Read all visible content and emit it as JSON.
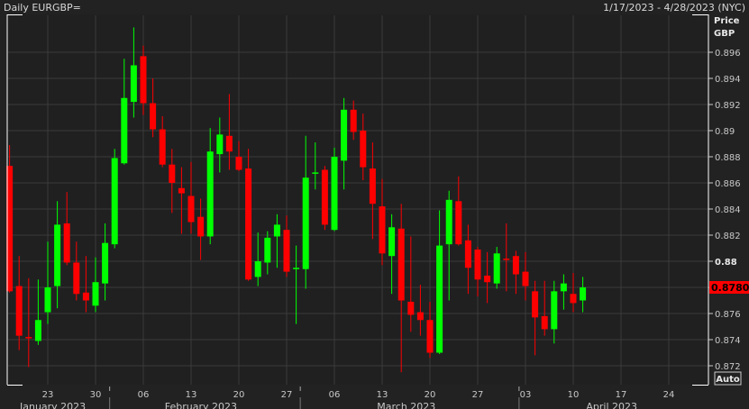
{
  "header": {
    "title": "Daily EURGBP=",
    "range": "1/17/2023 - 4/28/2023 (NYC)"
  },
  "axis": {
    "title_line1": "Price",
    "title_line2": "GBP",
    "auto_label": "Auto",
    "last_price_label": "0.8780"
  },
  "colors": {
    "up": "#00ff00",
    "down": "#ff0000",
    "grid": "#3a3a3a",
    "last_price_bg": "#ff0000"
  },
  "chart_data": {
    "type": "candlestick",
    "title": "Daily EURGBP=",
    "ylabel": "Price GBP",
    "ylim": [
      0.8708,
      0.8983
    ],
    "yticks": [
      "0.872",
      "0.874",
      "0.876",
      "0.878",
      "0.88",
      "0.882",
      "0.884",
      "0.886",
      "0.888",
      "0.89",
      "0.892",
      "0.894",
      "0.896"
    ],
    "ytick_values": [
      0.872,
      0.874,
      0.876,
      0.878,
      0.88,
      0.882,
      0.884,
      0.886,
      0.888,
      0.89,
      0.892,
      0.894,
      0.896
    ],
    "xticks": [
      "23",
      "30",
      "06",
      "13",
      "20",
      "27",
      "06",
      "13",
      "20",
      "27",
      "03",
      "10",
      "17",
      "24"
    ],
    "xtick_day_index": [
      4,
      9,
      14,
      19,
      24,
      29,
      34,
      39,
      44,
      49,
      54,
      59,
      64,
      69
    ],
    "months": [
      {
        "label": "January 2023",
        "center_day": 5
      },
      {
        "label": "February 2023",
        "center_day": 20.5
      },
      {
        "label": "March 2023",
        "center_day": 42
      },
      {
        "label": "April 2023",
        "center_day": 63.5
      }
    ],
    "month_boundaries_day": [
      10.95,
      30.9,
      53.8
    ],
    "last_price": 0.878,
    "ohlc": [
      [
        0.8873,
        0.8889,
        0.8776,
        0.8777
      ],
      [
        0.8781,
        0.8804,
        0.8732,
        0.8743
      ],
      [
        0.8742,
        0.8787,
        0.8719,
        0.8741
      ],
      [
        0.8739,
        0.8786,
        0.8736,
        0.8755
      ],
      [
        0.8761,
        0.8815,
        0.8752,
        0.878
      ],
      [
        0.8781,
        0.8846,
        0.8764,
        0.8828
      ],
      [
        0.8829,
        0.8853,
        0.8797,
        0.8799
      ],
      [
        0.8799,
        0.8815,
        0.877,
        0.8775
      ],
      [
        0.8776,
        0.8804,
        0.8761,
        0.877
      ],
      [
        0.8766,
        0.8803,
        0.8761,
        0.8784
      ],
      [
        0.8783,
        0.8829,
        0.877,
        0.8814
      ],
      [
        0.8813,
        0.8886,
        0.881,
        0.8879
      ],
      [
        0.8875,
        0.8955,
        0.8874,
        0.8925
      ],
      [
        0.8922,
        0.8979,
        0.891,
        0.895
      ],
      [
        0.8957,
        0.8965,
        0.8912,
        0.8921
      ],
      [
        0.8921,
        0.894,
        0.8895,
        0.8901
      ],
      [
        0.8901,
        0.8911,
        0.8872,
        0.8874
      ],
      [
        0.8874,
        0.8886,
        0.8837,
        0.886
      ],
      [
        0.8856,
        0.8872,
        0.8821,
        0.8852
      ],
      [
        0.885,
        0.8876,
        0.8821,
        0.883
      ],
      [
        0.8834,
        0.8848,
        0.8801,
        0.8819
      ],
      [
        0.8819,
        0.8902,
        0.8813,
        0.8884
      ],
      [
        0.8882,
        0.891,
        0.8868,
        0.8897
      ],
      [
        0.8896,
        0.8928,
        0.887,
        0.8884
      ],
      [
        0.888,
        0.8892,
        0.8869,
        0.887
      ],
      [
        0.8871,
        0.8886,
        0.8785,
        0.8786
      ],
      [
        0.8788,
        0.8822,
        0.8781,
        0.88
      ],
      [
        0.8799,
        0.8823,
        0.879,
        0.8818
      ],
      [
        0.8819,
        0.8836,
        0.8795,
        0.8828
      ],
      [
        0.8824,
        0.8835,
        0.8788,
        0.8792
      ],
      [
        0.8795,
        0.8812,
        0.8752,
        0.8795
      ],
      [
        0.8794,
        0.8896,
        0.8779,
        0.8864
      ],
      [
        0.8868,
        0.8891,
        0.8855,
        0.8868
      ],
      [
        0.887,
        0.8873,
        0.8824,
        0.8828
      ],
      [
        0.8824,
        0.8887,
        0.8823,
        0.888
      ],
      [
        0.8877,
        0.8925,
        0.8855,
        0.8916
      ],
      [
        0.8916,
        0.8923,
        0.8893,
        0.8899
      ],
      [
        0.89,
        0.8913,
        0.8862,
        0.8872
      ],
      [
        0.8871,
        0.8891,
        0.8817,
        0.8844
      ],
      [
        0.8842,
        0.8863,
        0.8797,
        0.8806
      ],
      [
        0.8804,
        0.8836,
        0.8775,
        0.8826
      ],
      [
        0.8825,
        0.8844,
        0.8715,
        0.877
      ],
      [
        0.8769,
        0.8819,
        0.8746,
        0.8759
      ],
      [
        0.8761,
        0.8782,
        0.8743,
        0.8755
      ],
      [
        0.8755,
        0.8769,
        0.8726,
        0.873
      ],
      [
        0.873,
        0.8839,
        0.8729,
        0.8812
      ],
      [
        0.8813,
        0.8854,
        0.877,
        0.8847
      ],
      [
        0.8846,
        0.8865,
        0.8812,
        0.8813
      ],
      [
        0.8816,
        0.8828,
        0.8775,
        0.8795
      ],
      [
        0.8809,
        0.8811,
        0.8773,
        0.8786
      ],
      [
        0.8789,
        0.8807,
        0.8768,
        0.8784
      ],
      [
        0.8783,
        0.8811,
        0.8779,
        0.8806
      ],
      [
        0.8802,
        0.8829,
        0.8777,
        0.8801
      ],
      [
        0.8804,
        0.8808,
        0.8775,
        0.879
      ],
      [
        0.8792,
        0.8807,
        0.877,
        0.8781
      ],
      [
        0.8777,
        0.8785,
        0.8728,
        0.8757
      ],
      [
        0.8758,
        0.8785,
        0.8743,
        0.8748
      ],
      [
        0.8748,
        0.8785,
        0.8737,
        0.8777
      ],
      [
        0.8777,
        0.879,
        0.8763,
        0.8783
      ],
      [
        0.8775,
        0.8791,
        0.8761,
        0.8768
      ],
      [
        0.877,
        0.8788,
        0.8761,
        0.878
      ]
    ]
  }
}
